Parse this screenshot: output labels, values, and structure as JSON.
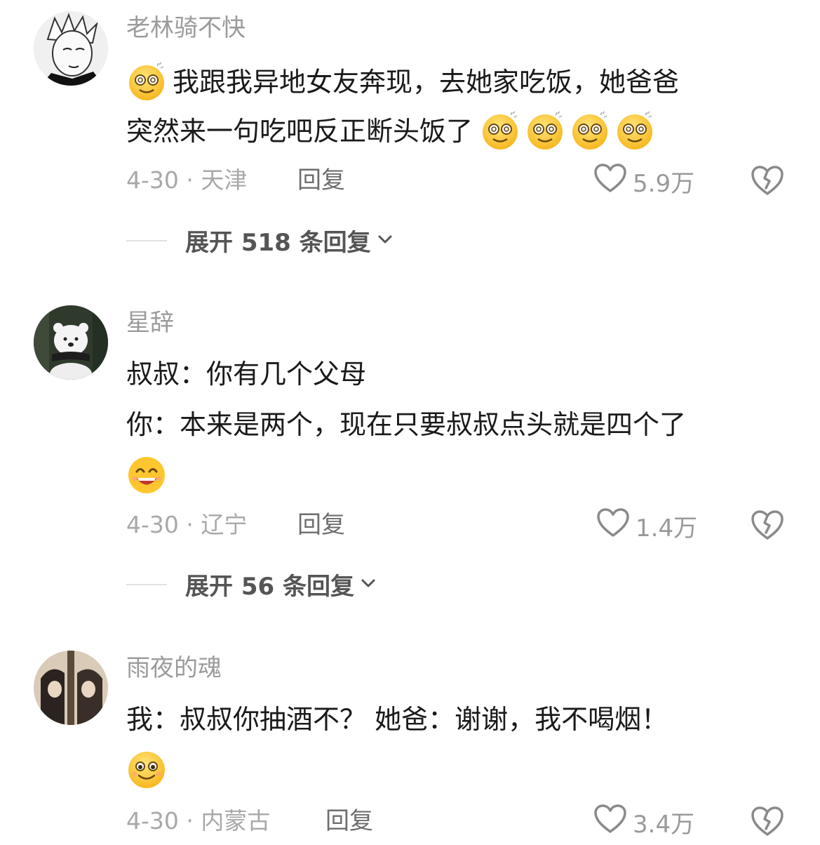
{
  "comments": [
    {
      "username": "老林骑不快",
      "line1": "我跟我异地女友奔现，去她家吃饭，她爸爸",
      "line2": "突然来一句吃吧反正断头饭了",
      "date_location": "4-30 · 天津",
      "reply_label": "回复",
      "likes": "5.9万",
      "expand_label": "展开 518 条回复",
      "emoji": "dizzy-smile"
    },
    {
      "username": "星辞",
      "line1": "叔叔：你有几个父母",
      "line2": "你：本来是两个，现在只要叔叔点头就是四个了",
      "date_location": "4-30 · 辽宁",
      "reply_label": "回复",
      "likes": "1.4万",
      "expand_label": "展开 56 条回复",
      "emoji": "grin"
    },
    {
      "username": "雨夜的魂",
      "line1": "我：叔叔你抽酒不？ 她爸：谢谢，我不喝烟！",
      "date_location": "4-30 · 内蒙古",
      "reply_label": "回复",
      "likes": "3.4万",
      "emoji": "smile"
    }
  ],
  "icons": {
    "like": "heart-outline-icon",
    "dislike": "broken-heart-icon",
    "expand": "chevron-down-icon"
  },
  "colors": {
    "username": "#9b9b9b",
    "body_text": "#1a1a1a",
    "meta": "#a8a8a8",
    "emoji_yellow": "#ffcf3a"
  }
}
